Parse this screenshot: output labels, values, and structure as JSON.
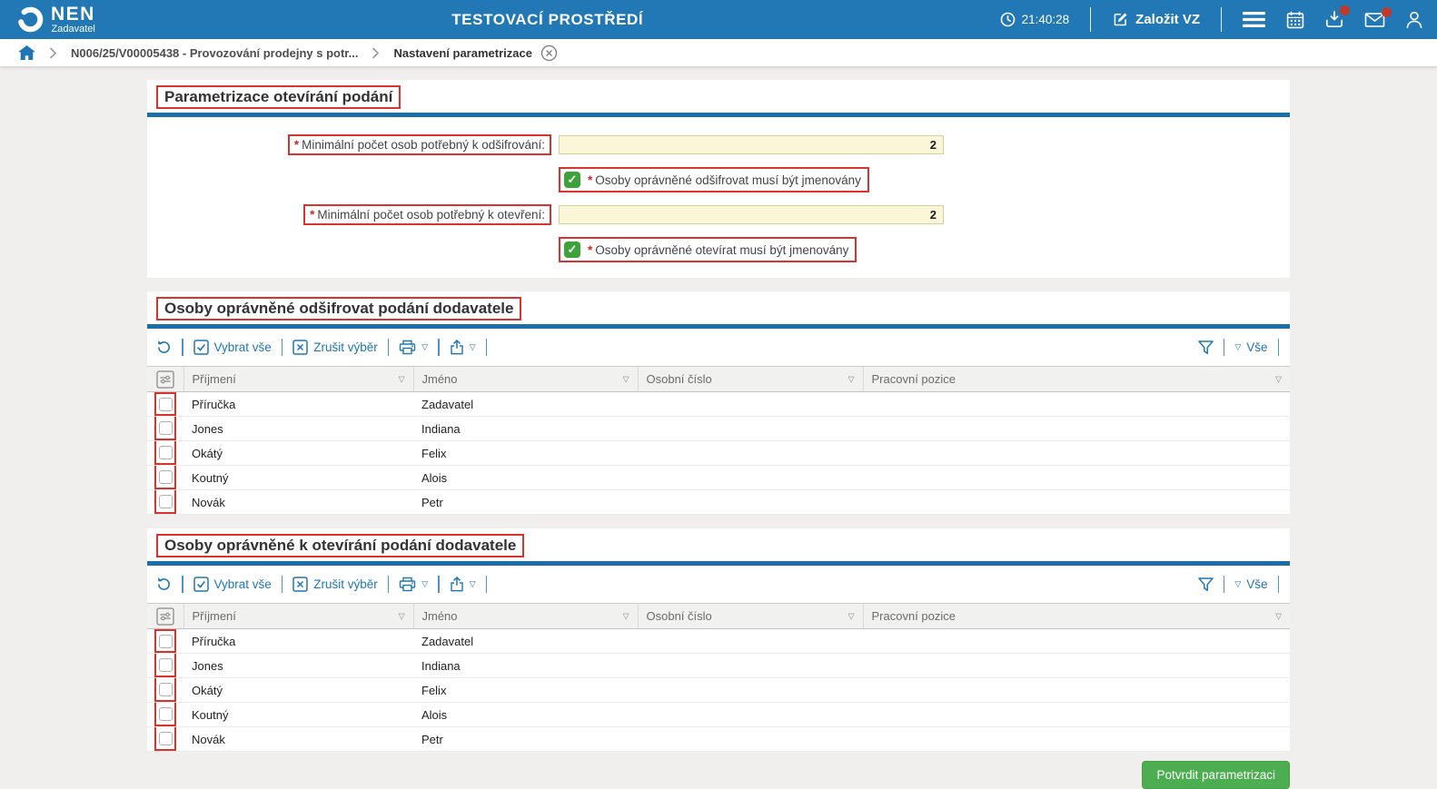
{
  "header": {
    "brand": "NEN",
    "brand_sub": "Zadavatel",
    "environment_title": "TESTOVACÍ PROSTŘEDÍ",
    "time": "21:40:28",
    "create_vz_label": "Založit VZ"
  },
  "breadcrumb": {
    "item1": "N006/25/V00005438 - Provozování prodejny s potr...",
    "item2": "Nastavení parametrizace"
  },
  "required_marker": "*",
  "icons": {
    "caret_down": "▽",
    "check": "✓"
  },
  "parametrization": {
    "title": "Parametrizace otevírání podání",
    "field1_label": "Minimální počet osob potřebný k odšifrování:",
    "field1_value": "2",
    "checkbox1_label": "Osoby oprávněné odšifrovat musí být jmenovány",
    "checkbox1_checked": true,
    "field2_label": "Minimální počet osob potřebný k otevření:",
    "field2_value": "2",
    "checkbox2_label": "Osoby oprávněné otevírat musí být jmenovány",
    "checkbox2_checked": true
  },
  "toolbar": {
    "select_all": "Vybrat vše",
    "clear_selection": "Zrušit výběr",
    "filter_all": "Vše"
  },
  "tables": [
    {
      "title": "Osoby oprávněné odšifrovat podání dodavatele",
      "columns": {
        "surname": "Příjmení",
        "name": "Jméno",
        "personal_number": "Osobní číslo",
        "position": "Pracovní pozice"
      },
      "rows": [
        {
          "surname": "Příručka",
          "name": "Zadavatel",
          "personal_number": "",
          "position": ""
        },
        {
          "surname": "Jones",
          "name": "Indiana",
          "personal_number": "",
          "position": ""
        },
        {
          "surname": "Okátý",
          "name": "Felix",
          "personal_number": "",
          "position": ""
        },
        {
          "surname": "Koutný",
          "name": "Alois",
          "personal_number": "",
          "position": ""
        },
        {
          "surname": "Novák",
          "name": "Petr",
          "personal_number": "",
          "position": ""
        }
      ]
    },
    {
      "title": "Osoby oprávněné k otevírání podání dodavatele",
      "columns": {
        "surname": "Příjmení",
        "name": "Jméno",
        "personal_number": "Osobní číslo",
        "position": "Pracovní pozice"
      },
      "rows": [
        {
          "surname": "Příručka",
          "name": "Zadavatel",
          "personal_number": "",
          "position": ""
        },
        {
          "surname": "Jones",
          "name": "Indiana",
          "personal_number": "",
          "position": ""
        },
        {
          "surname": "Okátý",
          "name": "Felix",
          "personal_number": "",
          "position": ""
        },
        {
          "surname": "Koutný",
          "name": "Alois",
          "personal_number": "",
          "position": ""
        },
        {
          "surname": "Novák",
          "name": "Petr",
          "personal_number": "",
          "position": ""
        }
      ]
    }
  ],
  "footer": {
    "confirm_label": "Potvrdit parametrizaci"
  },
  "colors": {
    "header_blue": "#2178b5",
    "section_bar_blue": "#1b6ea8",
    "link_blue": "#2076b4",
    "annotation_red": "#d6342c",
    "input_yellow": "#fcf6d8",
    "checkbox_green": "#3ea23b",
    "confirm_green": "#4cae50",
    "badge_red": "#c0392b"
  }
}
